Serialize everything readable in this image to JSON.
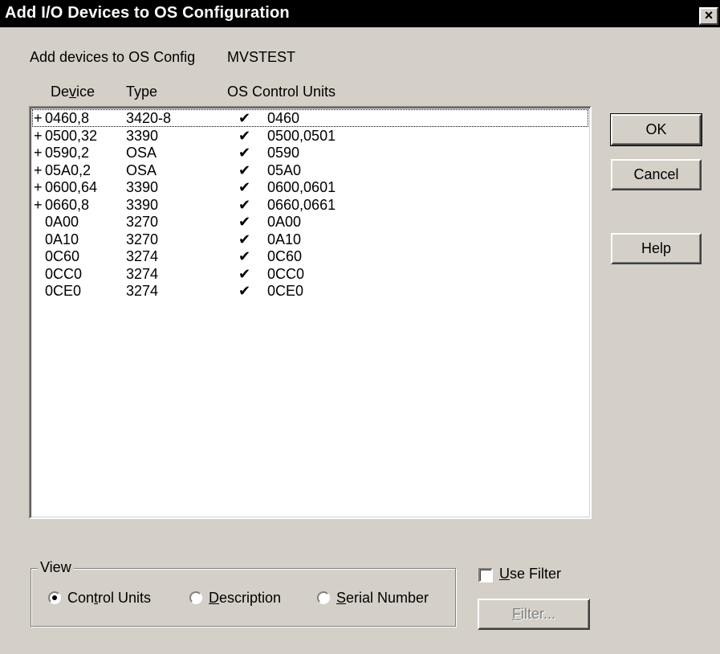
{
  "window": {
    "title": "Add I/O Devices to OS Configuration",
    "close_glyph": "×"
  },
  "header": {
    "add_label": "Add devices to OS Config",
    "config_name": "MVSTEST"
  },
  "columns": {
    "device": "Device",
    "type": "Type",
    "os_control_units": "OS Control Units"
  },
  "rows": [
    {
      "expand": "+",
      "device": "0460,8",
      "type": "3420-8",
      "check": "✔",
      "control_units": "0460"
    },
    {
      "expand": "+",
      "device": "0500,32",
      "type": "3390",
      "check": "✔",
      "control_units": "0500,0501"
    },
    {
      "expand": "+",
      "device": "0590,2",
      "type": "OSA",
      "check": "✔",
      "control_units": "0590"
    },
    {
      "expand": "+",
      "device": "05A0,2",
      "type": "OSA",
      "check": "✔",
      "control_units": "05A0"
    },
    {
      "expand": "+",
      "device": "0600,64",
      "type": "3390",
      "check": "✔",
      "control_units": "0600,0601"
    },
    {
      "expand": "+",
      "device": "0660,8",
      "type": "3390",
      "check": "✔",
      "control_units": "0660,0661"
    },
    {
      "expand": "",
      "device": "0A00",
      "type": "3270",
      "check": "✔",
      "control_units": "0A00"
    },
    {
      "expand": "",
      "device": "0A10",
      "type": "3270",
      "check": "✔",
      "control_units": "0A10"
    },
    {
      "expand": "",
      "device": "0C60",
      "type": "3274",
      "check": "✔",
      "control_units": "0C60"
    },
    {
      "expand": "",
      "device": "0CC0",
      "type": "3274",
      "check": "✔",
      "control_units": "0CC0"
    },
    {
      "expand": "",
      "device": "0CE0",
      "type": "3274",
      "check": "✔",
      "control_units": "0CE0"
    }
  ],
  "buttons": {
    "ok": "OK",
    "cancel": "Cancel",
    "help": "Help",
    "filter": "Filter..."
  },
  "view": {
    "title": "View",
    "options": [
      "Control Units",
      "Description",
      "Serial Number"
    ],
    "selected": "Control Units"
  },
  "use_filter": {
    "label": "Use Filter",
    "checked": false
  }
}
